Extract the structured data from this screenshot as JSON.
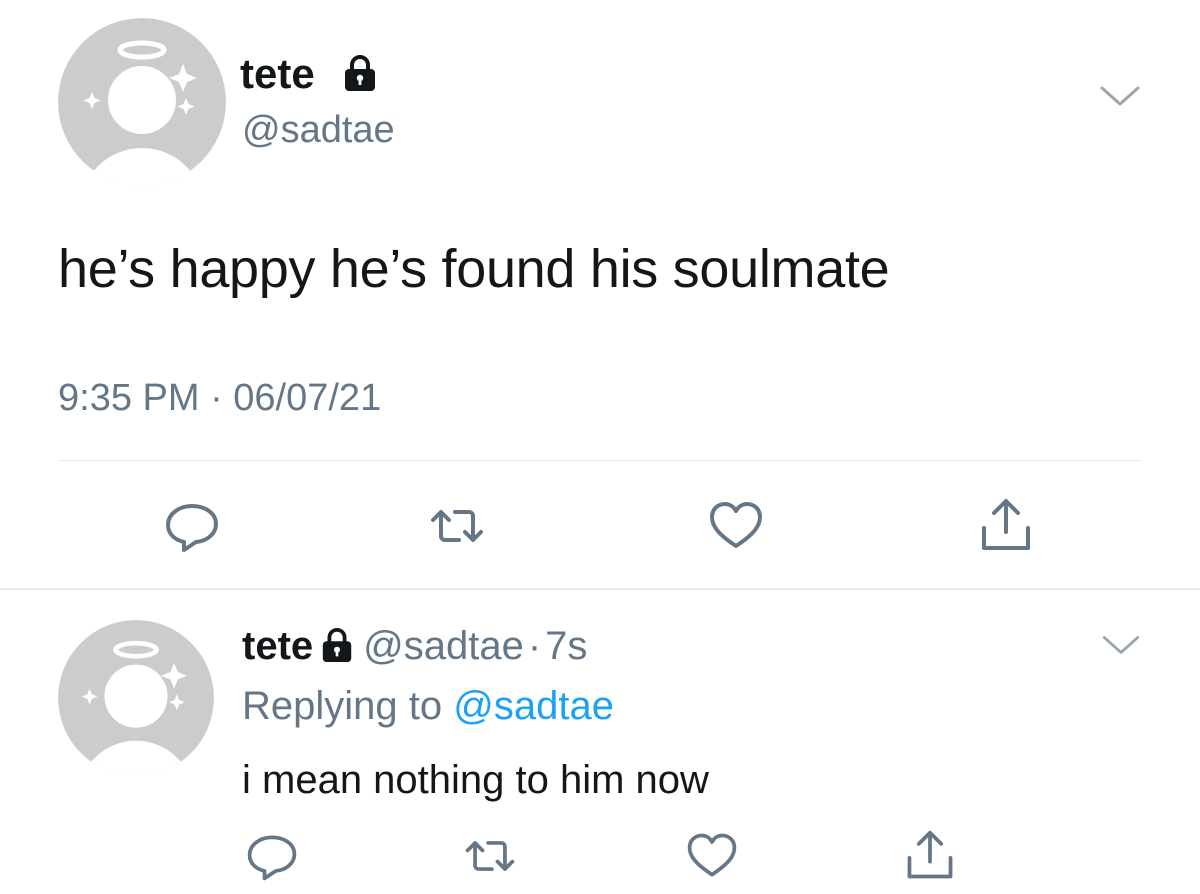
{
  "main_tweet": {
    "display_name": "tete",
    "handle": "@sadtae",
    "text": "he’s happy he’s found his soulmate",
    "timestamp": "9:35 PM · 06/07/21",
    "avatar_icon": "default-angel-avatar-icon",
    "protected_icon": "lock-icon",
    "menu_icon": "chevron-down-icon"
  },
  "reply_tweet": {
    "display_name": "tete",
    "handle": "@sadtae",
    "separator": "·",
    "age": "7s",
    "replying_prefix": "Replying to",
    "replying_to": "@sadtae",
    "text": "i mean nothing to him now"
  },
  "actions": [
    "reply-icon",
    "retweet-icon",
    "like-icon",
    "share-icon"
  ],
  "colors": {
    "text": "#14171a",
    "muted": "#657786",
    "link": "#1da1f2",
    "icon": "#657786",
    "avatar": "#cccccc",
    "divider": "#e6ecf0"
  }
}
